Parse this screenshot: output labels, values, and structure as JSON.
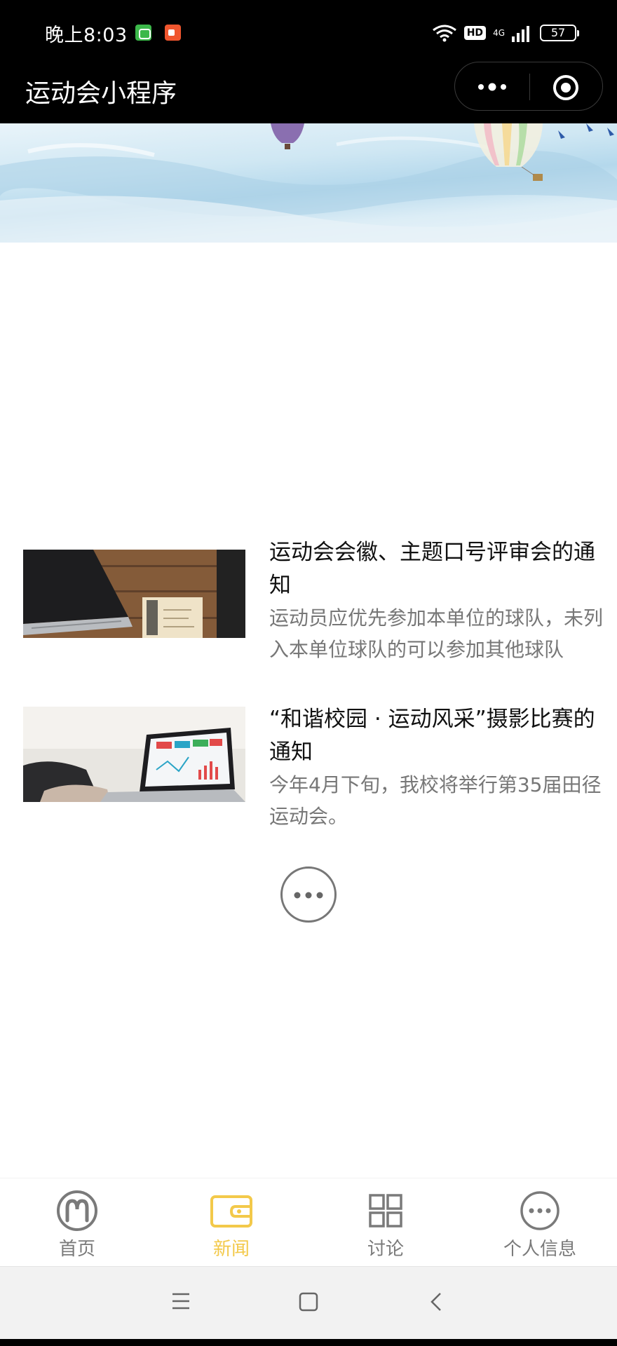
{
  "status_bar": {
    "time": "晚上8:03",
    "hd": "HD",
    "network": "4G",
    "battery": "57"
  },
  "nav": {
    "title": "运动会小程序"
  },
  "news": [
    {
      "title": "运动会会徽、主题口号评审会的通知",
      "summary": "运动员应优先参加本单位的球队，未列入本单位球队的可以参加其他球队"
    },
    {
      "title": "“和谐校园 · 运动风采”摄影比赛的通知",
      "summary": "今年4月下旬，我校将举行第35届田径运动会。"
    }
  ],
  "tabs": [
    {
      "label": "首页",
      "icon": "mcdonalds-logo-icon"
    },
    {
      "label": "新闻",
      "icon": "wallet-icon",
      "active": true
    },
    {
      "label": "讨论",
      "icon": "grid-icon"
    },
    {
      "label": "个人信息",
      "icon": "more-circle-icon"
    }
  ],
  "colors": {
    "accent": "#f3c94a",
    "tab_inactive": "#7a7a7a",
    "summary_text": "#777777",
    "nav_background": "#000000"
  }
}
